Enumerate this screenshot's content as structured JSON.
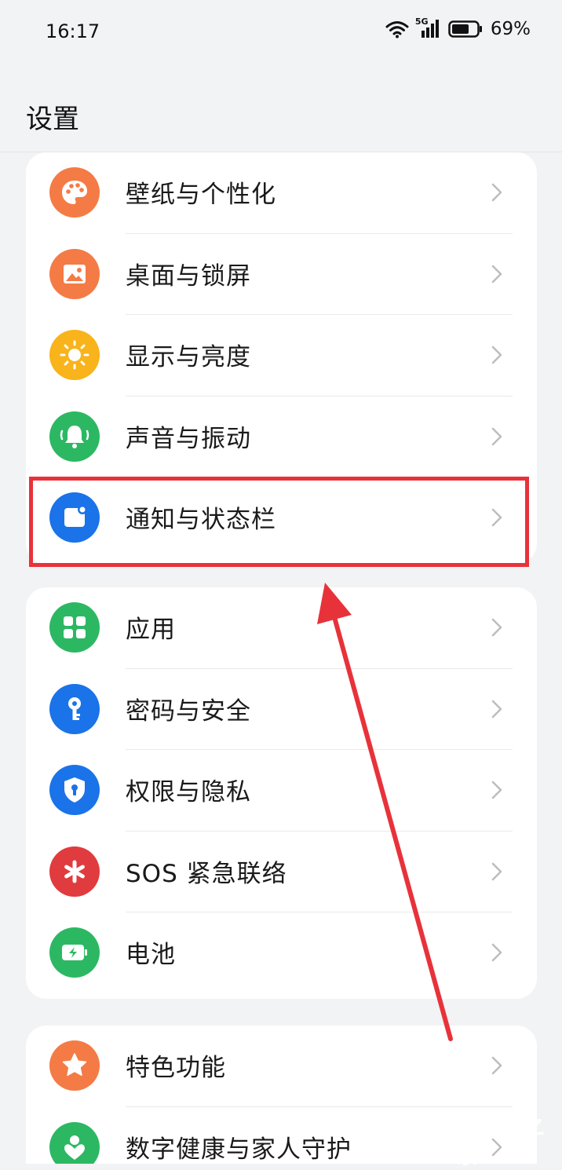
{
  "status_bar": {
    "time": "16:17",
    "network": "5G",
    "battery": "69%"
  },
  "header": {
    "title": "设置"
  },
  "groups": [
    {
      "items": [
        {
          "label": "壁纸与个性化",
          "icon": "palette-icon",
          "color": "#f47b45"
        },
        {
          "label": "桌面与锁屏",
          "icon": "image-icon",
          "color": "#f47b45"
        },
        {
          "label": "显示与亮度",
          "icon": "sun-icon",
          "color": "#f9b31b"
        },
        {
          "label": "声音与振动",
          "icon": "bell-icon",
          "color": "#2cb863"
        },
        {
          "label": "通知与状态栏",
          "icon": "notification-icon",
          "color": "#1a73e8"
        }
      ]
    },
    {
      "items": [
        {
          "label": "应用",
          "icon": "apps-grid-icon",
          "color": "#2cb863"
        },
        {
          "label": "密码与安全",
          "icon": "key-icon",
          "color": "#1a73e8"
        },
        {
          "label": "权限与隐私",
          "icon": "shield-lock-icon",
          "color": "#1a73e8"
        },
        {
          "label": "SOS 紧急联络",
          "icon": "asterisk-icon",
          "color": "#e03b3e"
        },
        {
          "label": "电池",
          "icon": "battery-icon",
          "color": "#2cb863"
        }
      ]
    },
    {
      "items": [
        {
          "label": "特色功能",
          "icon": "star-icon",
          "color": "#f47b45"
        },
        {
          "label": "数字健康与家人守护",
          "icon": "heart-person-icon",
          "color": "#2cb863"
        }
      ]
    }
  ],
  "annotation": {
    "highlight_color": "#e8323a"
  },
  "watermark": {
    "text": "OPPO之家"
  }
}
